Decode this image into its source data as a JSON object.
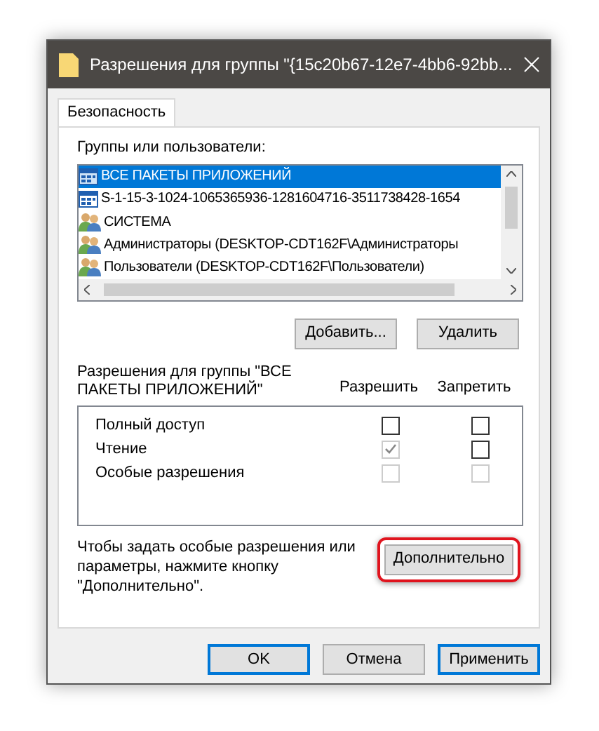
{
  "window": {
    "title": "Разрешения для группы \"{15c20b67-12e7-4bb6-92bb..."
  },
  "tabs": [
    {
      "label": "Безопасность",
      "selected": true
    }
  ],
  "groups": {
    "label": "Группы или пользователи:",
    "items": [
      {
        "name": "ВСЕ ПАКЕТЫ ПРИЛОЖЕНИЙ",
        "kind": "package",
        "selected": true
      },
      {
        "name": "S-1-15-3-1024-1065365936-1281604716-3511738428-1654",
        "kind": "package",
        "selected": false
      },
      {
        "name": "СИСТЕМА",
        "kind": "users",
        "selected": false
      },
      {
        "name": "Администраторы (DESKTOP-CDT162F\\Администраторы",
        "kind": "users",
        "selected": false
      },
      {
        "name": "Пользователи (DESKTOP-CDT162F\\Пользователи)",
        "kind": "users",
        "selected": false
      }
    ],
    "buttons": [
      "Добавить...",
      "Удалить"
    ]
  },
  "permissions": {
    "label": "Разрешения для группы \"ВСЕ ПАКЕТЫ ПРИЛОЖЕНИЙ\"",
    "columns": [
      "Разрешить",
      "Запретить"
    ],
    "rows": [
      {
        "name": "Полный доступ",
        "allow": {
          "checked": false,
          "disabled": false
        },
        "deny": {
          "checked": false,
          "disabled": false
        }
      },
      {
        "name": "Чтение",
        "allow": {
          "checked": true,
          "disabled": true
        },
        "deny": {
          "checked": false,
          "disabled": false
        }
      },
      {
        "name": "Особые разрешения",
        "allow": {
          "checked": false,
          "disabled": true
        },
        "deny": {
          "checked": false,
          "disabled": true
        }
      }
    ]
  },
  "advanced": {
    "text": "Чтобы задать особые разрешения или параметры, нажмите кнопку \"Дополнительно\".",
    "button": "Дополнительно",
    "highlighted": true
  },
  "footer_buttons": [
    {
      "label": "OK",
      "default": true
    },
    {
      "label": "Отмена",
      "default": false
    },
    {
      "label": "Применить",
      "default": true
    }
  ]
}
